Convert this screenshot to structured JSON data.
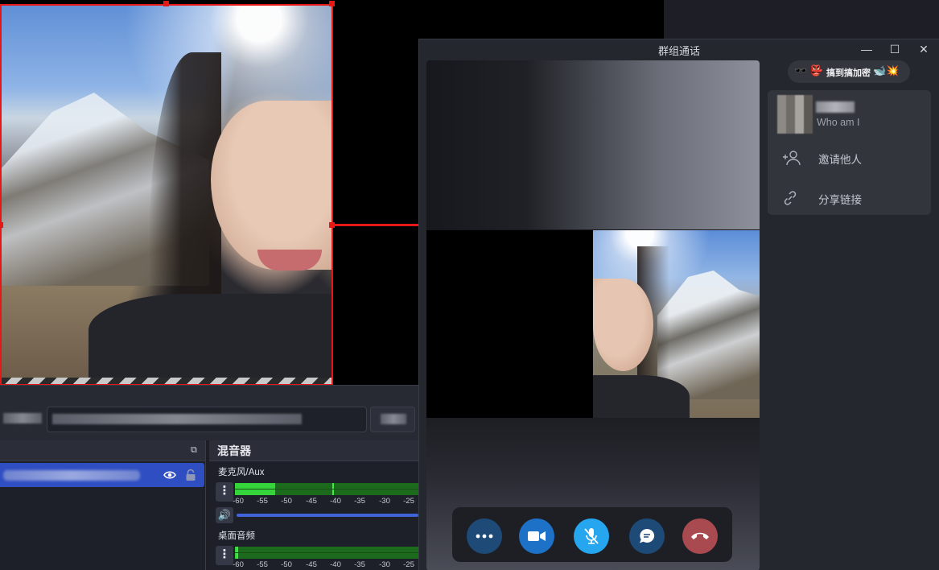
{
  "call_window": {
    "title": "群组通话",
    "controls": {
      "minimize": "—",
      "maximize": "☐",
      "close": "✕"
    },
    "participant": {
      "name_prefix": "🕶️ 👺",
      "name": "搞到搞加密",
      "name_suffix": "🐋💥",
      "status": "Who am I"
    },
    "actions": [
      {
        "label": "邀请他人",
        "icon": "add-person-icon"
      },
      {
        "label": "分享链接",
        "icon": "link-icon"
      }
    ],
    "toolbar": [
      {
        "name": "more",
        "icon": "more-icon",
        "color": "#1e4a78"
      },
      {
        "name": "video",
        "icon": "camera-icon",
        "color": "#1d71c7"
      },
      {
        "name": "mute",
        "icon": "mic-off-icon",
        "color": "#25a6ef"
      },
      {
        "name": "chat",
        "icon": "chat-icon",
        "color": "#1e4a78"
      },
      {
        "name": "end-call",
        "icon": "hangup-icon",
        "color": "#a84a50"
      }
    ]
  },
  "obs": {
    "mixer": {
      "title": "混音器",
      "channels": [
        {
          "name": "麦克风/Aux",
          "level": 0.22,
          "peak": 0.53
        },
        {
          "name": "桌面音频",
          "level": 0.0,
          "peak": 0.0
        }
      ],
      "ticks": [
        "-60",
        "-55",
        "-50",
        "-45",
        "-40",
        "-35",
        "-30",
        "-25"
      ]
    }
  }
}
